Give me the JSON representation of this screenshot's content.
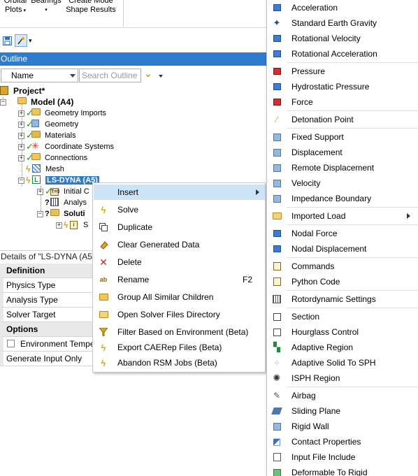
{
  "ribbon": {
    "group1_line1": "Orbital",
    "group1_line2": "Plots",
    "group2_line1": "Bearings",
    "group3_line1": "Create Mode",
    "group3_line2": "Shape Results"
  },
  "outline": {
    "title": "Outline",
    "name_select": "Name",
    "search_placeholder": "Search Outline"
  },
  "tree": {
    "project": "Project*",
    "model": "Model (A4)",
    "geometry_imports": "Geometry Imports",
    "geometry": "Geometry",
    "materials": "Materials",
    "coordinate_systems": "Coordinate Systems",
    "connections": "Connections",
    "mesh": "Mesh",
    "analysis": "LS-DYNA (A5)",
    "initial": "Initial C",
    "analysis_settings": "Analys",
    "solution": "Soluti",
    "solution_info": "S"
  },
  "details": {
    "title": "Details of \"LS-DYNA (A5",
    "rows": {
      "definition": "Definition",
      "physics_type": "Physics Type",
      "analysis_type": "Analysis Type",
      "solver_target": "Solver Target",
      "options": "Options",
      "environment_temp": "Environment Tempe",
      "generate_input": "Generate Input Only"
    }
  },
  "context_menu": {
    "insert": "Insert",
    "solve": "Solve",
    "duplicate": "Duplicate",
    "clear": "Clear Generated Data",
    "delete": "Delete",
    "rename": "Rename",
    "rename_shortcut": "F2",
    "group": "Group All Similar Children",
    "open_dir": "Open Solver Files Directory",
    "filter": "Filter Based on Environment (Beta)",
    "export": "Export CAERep Files (Beta)",
    "abandon": "Abandon RSM Jobs (Beta)"
  },
  "submenu": {
    "acceleration": "Acceleration",
    "gravity": "Standard Earth Gravity",
    "rot_velocity": "Rotational Velocity",
    "rot_accel": "Rotational Acceleration",
    "pressure": "Pressure",
    "hydro": "Hydrostatic Pressure",
    "force": "Force",
    "detonation": "Detonation Point",
    "fixed": "Fixed Support",
    "displacement": "Displacement",
    "remote_disp": "Remote Displacement",
    "velocity": "Velocity",
    "impedance": "Impedance Boundary",
    "imported_load": "Imported Load",
    "nodal_force": "Nodal Force",
    "nodal_disp": "Nodal Displacement",
    "commands": "Commands",
    "python": "Python Code",
    "rotordynamic": "Rotordynamic Settings",
    "section": "Section",
    "hourglass": "Hourglass Control",
    "adaptive_region": "Adaptive Region",
    "adaptive_sph": "Adaptive Solid To SPH",
    "isph": "ISPH Region",
    "airbag": "Airbag",
    "sliding": "Sliding Plane",
    "rigid_wall": "Rigid Wall",
    "contact_props": "Contact Properties",
    "input_include": "Input File Include",
    "deformable": "Deformable To Rigid"
  },
  "colors": {
    "accent": "#2e7ccd",
    "highlight": "#cde4f7",
    "check": "#1a9c1a",
    "lightning": "#d9a700"
  }
}
